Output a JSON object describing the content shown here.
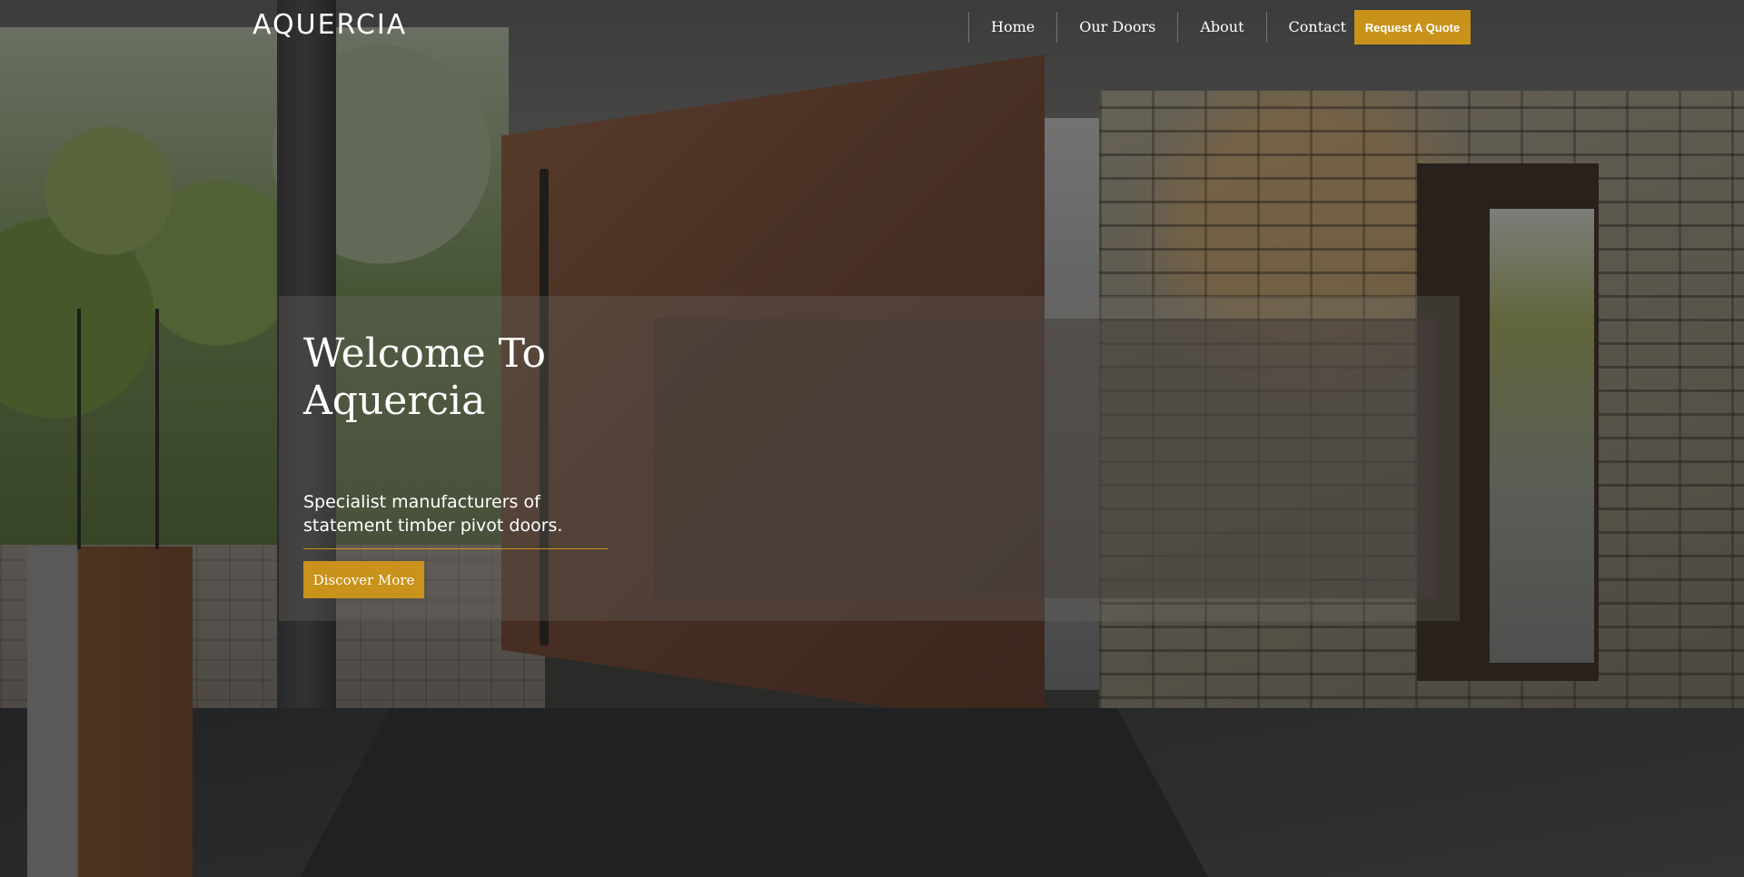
{
  "brand": {
    "logo_text": "AQUERCIA"
  },
  "nav": {
    "items": [
      {
        "label": "Home"
      },
      {
        "label": "Our Doors"
      },
      {
        "label": "About"
      },
      {
        "label": "Contact"
      }
    ],
    "cta_label": "Request A Quote"
  },
  "hero": {
    "headline": "Welcome To Aquercia",
    "subtitle": "Specialist manufacturers of statement timber pivot doors.",
    "button_label": "Discover More"
  },
  "colors": {
    "accent": "#c9921a",
    "text": "#ffffff"
  }
}
